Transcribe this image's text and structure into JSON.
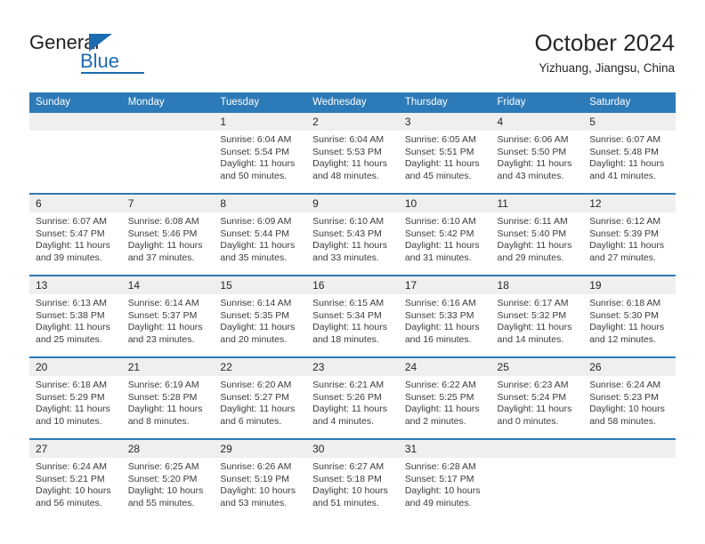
{
  "brand": {
    "name_part1": "General",
    "name_part2": "Blue",
    "accent_color": "#1d6bb0"
  },
  "header": {
    "title": "October 2024",
    "subtitle": "Yizhuang, Jiangsu, China",
    "header_bg_color": "#2d7ab8",
    "date_band_color": "#efefef"
  },
  "weekdays": [
    "Sunday",
    "Monday",
    "Tuesday",
    "Wednesday",
    "Thursday",
    "Friday",
    "Saturday"
  ],
  "weeks": [
    {
      "dates": [
        "",
        "",
        "1",
        "2",
        "3",
        "4",
        "5"
      ],
      "cells": [
        {
          "empty": true,
          "sunrise": "",
          "sunset": "",
          "daylight_line1": "",
          "daylight_line2": ""
        },
        {
          "empty": true,
          "sunrise": "",
          "sunset": "",
          "daylight_line1": "",
          "daylight_line2": ""
        },
        {
          "empty": false,
          "sunrise": "Sunrise: 6:04 AM",
          "sunset": "Sunset: 5:54 PM",
          "daylight_line1": "Daylight: 11 hours",
          "daylight_line2": "and 50 minutes."
        },
        {
          "empty": false,
          "sunrise": "Sunrise: 6:04 AM",
          "sunset": "Sunset: 5:53 PM",
          "daylight_line1": "Daylight: 11 hours",
          "daylight_line2": "and 48 minutes."
        },
        {
          "empty": false,
          "sunrise": "Sunrise: 6:05 AM",
          "sunset": "Sunset: 5:51 PM",
          "daylight_line1": "Daylight: 11 hours",
          "daylight_line2": "and 45 minutes."
        },
        {
          "empty": false,
          "sunrise": "Sunrise: 6:06 AM",
          "sunset": "Sunset: 5:50 PM",
          "daylight_line1": "Daylight: 11 hours",
          "daylight_line2": "and 43 minutes."
        },
        {
          "empty": false,
          "sunrise": "Sunrise: 6:07 AM",
          "sunset": "Sunset: 5:48 PM",
          "daylight_line1": "Daylight: 11 hours",
          "daylight_line2": "and 41 minutes."
        }
      ]
    },
    {
      "dates": [
        "6",
        "7",
        "8",
        "9",
        "10",
        "11",
        "12"
      ],
      "cells": [
        {
          "empty": false,
          "sunrise": "Sunrise: 6:07 AM",
          "sunset": "Sunset: 5:47 PM",
          "daylight_line1": "Daylight: 11 hours",
          "daylight_line2": "and 39 minutes."
        },
        {
          "empty": false,
          "sunrise": "Sunrise: 6:08 AM",
          "sunset": "Sunset: 5:46 PM",
          "daylight_line1": "Daylight: 11 hours",
          "daylight_line2": "and 37 minutes."
        },
        {
          "empty": false,
          "sunrise": "Sunrise: 6:09 AM",
          "sunset": "Sunset: 5:44 PM",
          "daylight_line1": "Daylight: 11 hours",
          "daylight_line2": "and 35 minutes."
        },
        {
          "empty": false,
          "sunrise": "Sunrise: 6:10 AM",
          "sunset": "Sunset: 5:43 PM",
          "daylight_line1": "Daylight: 11 hours",
          "daylight_line2": "and 33 minutes."
        },
        {
          "empty": false,
          "sunrise": "Sunrise: 6:10 AM",
          "sunset": "Sunset: 5:42 PM",
          "daylight_line1": "Daylight: 11 hours",
          "daylight_line2": "and 31 minutes."
        },
        {
          "empty": false,
          "sunrise": "Sunrise: 6:11 AM",
          "sunset": "Sunset: 5:40 PM",
          "daylight_line1": "Daylight: 11 hours",
          "daylight_line2": "and 29 minutes."
        },
        {
          "empty": false,
          "sunrise": "Sunrise: 6:12 AM",
          "sunset": "Sunset: 5:39 PM",
          "daylight_line1": "Daylight: 11 hours",
          "daylight_line2": "and 27 minutes."
        }
      ]
    },
    {
      "dates": [
        "13",
        "14",
        "15",
        "16",
        "17",
        "18",
        "19"
      ],
      "cells": [
        {
          "empty": false,
          "sunrise": "Sunrise: 6:13 AM",
          "sunset": "Sunset: 5:38 PM",
          "daylight_line1": "Daylight: 11 hours",
          "daylight_line2": "and 25 minutes."
        },
        {
          "empty": false,
          "sunrise": "Sunrise: 6:14 AM",
          "sunset": "Sunset: 5:37 PM",
          "daylight_line1": "Daylight: 11 hours",
          "daylight_line2": "and 23 minutes."
        },
        {
          "empty": false,
          "sunrise": "Sunrise: 6:14 AM",
          "sunset": "Sunset: 5:35 PM",
          "daylight_line1": "Daylight: 11 hours",
          "daylight_line2": "and 20 minutes."
        },
        {
          "empty": false,
          "sunrise": "Sunrise: 6:15 AM",
          "sunset": "Sunset: 5:34 PM",
          "daylight_line1": "Daylight: 11 hours",
          "daylight_line2": "and 18 minutes."
        },
        {
          "empty": false,
          "sunrise": "Sunrise: 6:16 AM",
          "sunset": "Sunset: 5:33 PM",
          "daylight_line1": "Daylight: 11 hours",
          "daylight_line2": "and 16 minutes."
        },
        {
          "empty": false,
          "sunrise": "Sunrise: 6:17 AM",
          "sunset": "Sunset: 5:32 PM",
          "daylight_line1": "Daylight: 11 hours",
          "daylight_line2": "and 14 minutes."
        },
        {
          "empty": false,
          "sunrise": "Sunrise: 6:18 AM",
          "sunset": "Sunset: 5:30 PM",
          "daylight_line1": "Daylight: 11 hours",
          "daylight_line2": "and 12 minutes."
        }
      ]
    },
    {
      "dates": [
        "20",
        "21",
        "22",
        "23",
        "24",
        "25",
        "26"
      ],
      "cells": [
        {
          "empty": false,
          "sunrise": "Sunrise: 6:18 AM",
          "sunset": "Sunset: 5:29 PM",
          "daylight_line1": "Daylight: 11 hours",
          "daylight_line2": "and 10 minutes."
        },
        {
          "empty": false,
          "sunrise": "Sunrise: 6:19 AM",
          "sunset": "Sunset: 5:28 PM",
          "daylight_line1": "Daylight: 11 hours",
          "daylight_line2": "and 8 minutes."
        },
        {
          "empty": false,
          "sunrise": "Sunrise: 6:20 AM",
          "sunset": "Sunset: 5:27 PM",
          "daylight_line1": "Daylight: 11 hours",
          "daylight_line2": "and 6 minutes."
        },
        {
          "empty": false,
          "sunrise": "Sunrise: 6:21 AM",
          "sunset": "Sunset: 5:26 PM",
          "daylight_line1": "Daylight: 11 hours",
          "daylight_line2": "and 4 minutes."
        },
        {
          "empty": false,
          "sunrise": "Sunrise: 6:22 AM",
          "sunset": "Sunset: 5:25 PM",
          "daylight_line1": "Daylight: 11 hours",
          "daylight_line2": "and 2 minutes."
        },
        {
          "empty": false,
          "sunrise": "Sunrise: 6:23 AM",
          "sunset": "Sunset: 5:24 PM",
          "daylight_line1": "Daylight: 11 hours",
          "daylight_line2": "and 0 minutes."
        },
        {
          "empty": false,
          "sunrise": "Sunrise: 6:24 AM",
          "sunset": "Sunset: 5:23 PM",
          "daylight_line1": "Daylight: 10 hours",
          "daylight_line2": "and 58 minutes."
        }
      ]
    },
    {
      "dates": [
        "27",
        "28",
        "29",
        "30",
        "31",
        "",
        ""
      ],
      "cells": [
        {
          "empty": false,
          "sunrise": "Sunrise: 6:24 AM",
          "sunset": "Sunset: 5:21 PM",
          "daylight_line1": "Daylight: 10 hours",
          "daylight_line2": "and 56 minutes."
        },
        {
          "empty": false,
          "sunrise": "Sunrise: 6:25 AM",
          "sunset": "Sunset: 5:20 PM",
          "daylight_line1": "Daylight: 10 hours",
          "daylight_line2": "and 55 minutes."
        },
        {
          "empty": false,
          "sunrise": "Sunrise: 6:26 AM",
          "sunset": "Sunset: 5:19 PM",
          "daylight_line1": "Daylight: 10 hours",
          "daylight_line2": "and 53 minutes."
        },
        {
          "empty": false,
          "sunrise": "Sunrise: 6:27 AM",
          "sunset": "Sunset: 5:18 PM",
          "daylight_line1": "Daylight: 10 hours",
          "daylight_line2": "and 51 minutes."
        },
        {
          "empty": false,
          "sunrise": "Sunrise: 6:28 AM",
          "sunset": "Sunset: 5:17 PM",
          "daylight_line1": "Daylight: 10 hours",
          "daylight_line2": "and 49 minutes."
        },
        {
          "empty": true,
          "sunrise": "",
          "sunset": "",
          "daylight_line1": "",
          "daylight_line2": ""
        },
        {
          "empty": true,
          "sunrise": "",
          "sunset": "",
          "daylight_line1": "",
          "daylight_line2": ""
        }
      ]
    }
  ]
}
